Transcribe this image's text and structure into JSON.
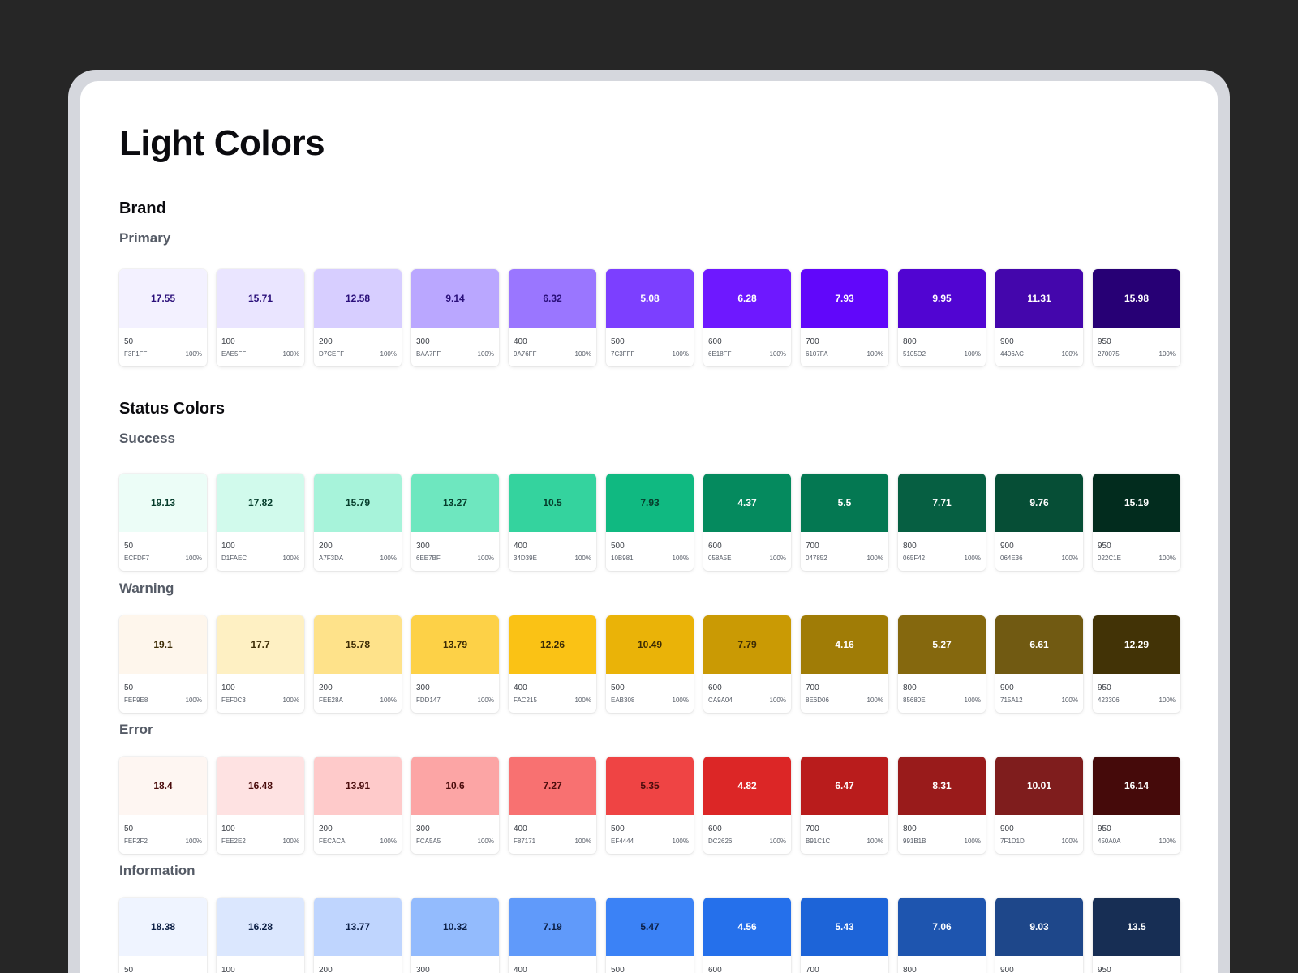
{
  "page_title": "Light Colors",
  "sections": [
    {
      "title": "Brand",
      "groups": [
        {
          "title": "Primary",
          "swatches": [
            {
              "ratio": "17.55",
              "step": "50",
              "hex": "F3F1FF",
              "opacity": "100%",
              "color": "#F3F1FF",
              "text_color": "#2a0f7a"
            },
            {
              "ratio": "15.71",
              "step": "100",
              "hex": "EAE5FF",
              "opacity": "100%",
              "color": "#EAE5FF",
              "text_color": "#2a0f7a"
            },
            {
              "ratio": "12.58",
              "step": "200",
              "hex": "D7CEFF",
              "opacity": "100%",
              "color": "#D7CEFF",
              "text_color": "#2a0f7a"
            },
            {
              "ratio": "9.14",
              "step": "300",
              "hex": "BAA7FF",
              "opacity": "100%",
              "color": "#BAA7FF",
              "text_color": "#2a0f7a"
            },
            {
              "ratio": "6.32",
              "step": "400",
              "hex": "9A76FF",
              "opacity": "100%",
              "color": "#9A76FF",
              "text_color": "#2a0f7a"
            },
            {
              "ratio": "5.08",
              "step": "500",
              "hex": "7C3FFF",
              "opacity": "100%",
              "color": "#7C3FFF",
              "text_color": "#ffffff"
            },
            {
              "ratio": "6.28",
              "step": "600",
              "hex": "6E18FF",
              "opacity": "100%",
              "color": "#6E18FF",
              "text_color": "#ffffff"
            },
            {
              "ratio": "7.93",
              "step": "700",
              "hex": "6107FA",
              "opacity": "100%",
              "color": "#6107FA",
              "text_color": "#ffffff"
            },
            {
              "ratio": "9.95",
              "step": "800",
              "hex": "5105D2",
              "opacity": "100%",
              "color": "#5105D2",
              "text_color": "#ffffff"
            },
            {
              "ratio": "11.31",
              "step": "900",
              "hex": "4406AC",
              "opacity": "100%",
              "color": "#4406AC",
              "text_color": "#ffffff"
            },
            {
              "ratio": "15.98",
              "step": "950",
              "hex": "270075",
              "opacity": "100%",
              "color": "#270075",
              "text_color": "#ffffff"
            }
          ]
        }
      ]
    },
    {
      "title": "Status Colors",
      "groups": [
        {
          "title": "Success",
          "swatches": [
            {
              "ratio": "19.13",
              "step": "50",
              "hex": "ECFDF7",
              "opacity": "100%",
              "color": "#ECFDF7",
              "text_color": "#063d2c"
            },
            {
              "ratio": "17.82",
              "step": "100",
              "hex": "D1FAEC",
              "opacity": "100%",
              "color": "#D1FAEC",
              "text_color": "#063d2c"
            },
            {
              "ratio": "15.79",
              "step": "200",
              "hex": "A7F3DA",
              "opacity": "100%",
              "color": "#A7F3DA",
              "text_color": "#063d2c"
            },
            {
              "ratio": "13.27",
              "step": "300",
              "hex": "6EE7BF",
              "opacity": "100%",
              "color": "#6EE7BF",
              "text_color": "#063d2c"
            },
            {
              "ratio": "10.5",
              "step": "400",
              "hex": "34D39E",
              "opacity": "100%",
              "color": "#34D39E",
              "text_color": "#063d2c"
            },
            {
              "ratio": "7.93",
              "step": "500",
              "hex": "10B981",
              "opacity": "100%",
              "color": "#10B981",
              "text_color": "#063d2c"
            },
            {
              "ratio": "4.37",
              "step": "600",
              "hex": "058A5E",
              "opacity": "100%",
              "color": "#058A5E",
              "text_color": "#ffffff"
            },
            {
              "ratio": "5.5",
              "step": "700",
              "hex": "047852",
              "opacity": "100%",
              "color": "#047852",
              "text_color": "#ffffff"
            },
            {
              "ratio": "7.71",
              "step": "800",
              "hex": "065F42",
              "opacity": "100%",
              "color": "#065F42",
              "text_color": "#ffffff"
            },
            {
              "ratio": "9.76",
              "step": "900",
              "hex": "064E36",
              "opacity": "100%",
              "color": "#064E36",
              "text_color": "#ffffff"
            },
            {
              "ratio": "15.19",
              "step": "950",
              "hex": "022C1E",
              "opacity": "100%",
              "color": "#022C1E",
              "text_color": "#ffffff"
            }
          ]
        },
        {
          "title": "Warning",
          "swatches": [
            {
              "ratio": "19.1",
              "step": "50",
              "hex": "FEF9E8",
              "opacity": "100%",
              "color": "#FEF6EC",
              "text_color": "#3d2c05"
            },
            {
              "ratio": "17.7",
              "step": "100",
              "hex": "FEF0C3",
              "opacity": "100%",
              "color": "#FEF0C3",
              "text_color": "#3d2c05"
            },
            {
              "ratio": "15.78",
              "step": "200",
              "hex": "FEE28A",
              "opacity": "100%",
              "color": "#FEE28A",
              "text_color": "#3d2c05"
            },
            {
              "ratio": "13.79",
              "step": "300",
              "hex": "FDD147",
              "opacity": "100%",
              "color": "#FDD147",
              "text_color": "#3d2c05"
            },
            {
              "ratio": "12.26",
              "step": "400",
              "hex": "FAC215",
              "opacity": "100%",
              "color": "#FAC215",
              "text_color": "#3d2c05"
            },
            {
              "ratio": "10.49",
              "step": "500",
              "hex": "EAB308",
              "opacity": "100%",
              "color": "#EAB308",
              "text_color": "#3d2c05"
            },
            {
              "ratio": "7.79",
              "step": "600",
              "hex": "CA9A04",
              "opacity": "100%",
              "color": "#CA9A04",
              "text_color": "#3d2c05"
            },
            {
              "ratio": "4.16",
              "step": "700",
              "hex": "8E6D06",
              "opacity": "100%",
              "color": "#A07C06",
              "text_color": "#ffffff"
            },
            {
              "ratio": "5.27",
              "step": "800",
              "hex": "85680E",
              "opacity": "100%",
              "color": "#85680E",
              "text_color": "#ffffff"
            },
            {
              "ratio": "6.61",
              "step": "900",
              "hex": "715A12",
              "opacity": "100%",
              "color": "#715A12",
              "text_color": "#ffffff"
            },
            {
              "ratio": "12.29",
              "step": "950",
              "hex": "423306",
              "opacity": "100%",
              "color": "#423306",
              "text_color": "#ffffff"
            }
          ]
        },
        {
          "title": "Error",
          "swatches": [
            {
              "ratio": "18.4",
              "step": "50",
              "hex": "FEF2F2",
              "opacity": "100%",
              "color": "#FEF6F2",
              "text_color": "#4a0c0c"
            },
            {
              "ratio": "16.48",
              "step": "100",
              "hex": "FEE2E2",
              "opacity": "100%",
              "color": "#FEE2E2",
              "text_color": "#4a0c0c"
            },
            {
              "ratio": "13.91",
              "step": "200",
              "hex": "FECACA",
              "opacity": "100%",
              "color": "#FECACA",
              "text_color": "#4a0c0c"
            },
            {
              "ratio": "10.6",
              "step": "300",
              "hex": "FCA5A5",
              "opacity": "100%",
              "color": "#FCA5A5",
              "text_color": "#4a0c0c"
            },
            {
              "ratio": "7.27",
              "step": "400",
              "hex": "F87171",
              "opacity": "100%",
              "color": "#F87171",
              "text_color": "#4a0c0c"
            },
            {
              "ratio": "5.35",
              "step": "500",
              "hex": "EF4444",
              "opacity": "100%",
              "color": "#EF4444",
              "text_color": "#4a0c0c"
            },
            {
              "ratio": "4.82",
              "step": "600",
              "hex": "DC2626",
              "opacity": "100%",
              "color": "#DC2626",
              "text_color": "#ffffff"
            },
            {
              "ratio": "6.47",
              "step": "700",
              "hex": "B91C1C",
              "opacity": "100%",
              "color": "#B91C1C",
              "text_color": "#ffffff"
            },
            {
              "ratio": "8.31",
              "step": "800",
              "hex": "991B1B",
              "opacity": "100%",
              "color": "#991B1B",
              "text_color": "#ffffff"
            },
            {
              "ratio": "10.01",
              "step": "900",
              "hex": "7F1D1D",
              "opacity": "100%",
              "color": "#7F1D1D",
              "text_color": "#ffffff"
            },
            {
              "ratio": "16.14",
              "step": "950",
              "hex": "450A0A",
              "opacity": "100%",
              "color": "#450A0A",
              "text_color": "#ffffff"
            }
          ]
        },
        {
          "title": "Information",
          "swatches": [
            {
              "ratio": "18.38",
              "step": "50",
              "hex": "",
              "opacity": "",
              "color": "#EFF4FF",
              "text_color": "#0c1f45"
            },
            {
              "ratio": "16.28",
              "step": "100",
              "hex": "",
              "opacity": "",
              "color": "#DBE7FE",
              "text_color": "#0c1f45"
            },
            {
              "ratio": "13.77",
              "step": "200",
              "hex": "",
              "opacity": "",
              "color": "#BFD5FE",
              "text_color": "#0c1f45"
            },
            {
              "ratio": "10.32",
              "step": "300",
              "hex": "",
              "opacity": "",
              "color": "#93BBFD",
              "text_color": "#0c1f45"
            },
            {
              "ratio": "7.19",
              "step": "400",
              "hex": "",
              "opacity": "",
              "color": "#609AFA",
              "text_color": "#0c1f45"
            },
            {
              "ratio": "5.47",
              "step": "500",
              "hex": "",
              "opacity": "",
              "color": "#3B82F6",
              "text_color": "#0c1f45"
            },
            {
              "ratio": "4.56",
              "step": "600",
              "hex": "",
              "opacity": "",
              "color": "#2570EB",
              "text_color": "#ffffff"
            },
            {
              "ratio": "5.43",
              "step": "700",
              "hex": "",
              "opacity": "",
              "color": "#1D64D8",
              "text_color": "#ffffff"
            },
            {
              "ratio": "7.06",
              "step": "800",
              "hex": "",
              "opacity": "",
              "color": "#1E55AF",
              "text_color": "#ffffff"
            },
            {
              "ratio": "9.03",
              "step": "900",
              "hex": "",
              "opacity": "",
              "color": "#1E478A",
              "text_color": "#ffffff"
            },
            {
              "ratio": "13.5",
              "step": "950",
              "hex": "",
              "opacity": "",
              "color": "#172E54",
              "text_color": "#ffffff"
            }
          ]
        }
      ]
    }
  ]
}
